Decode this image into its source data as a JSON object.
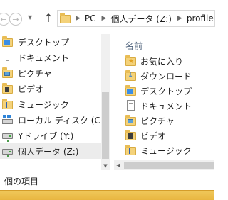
{
  "breadcrumb": {
    "items": [
      "PC",
      "個人データ (Z:)",
      "profile"
    ]
  },
  "navpane": {
    "items": [
      {
        "label": "デスクトップ",
        "icon": "desktop-folder-icon"
      },
      {
        "label": "ドキュメント",
        "icon": "documents-folder-icon"
      },
      {
        "label": "ピクチャ",
        "icon": "pictures-folder-icon"
      },
      {
        "label": "ビデオ",
        "icon": "videos-folder-icon"
      },
      {
        "label": "ミュージック",
        "icon": "music-folder-icon"
      },
      {
        "label": "ローカル ディスク (C:)",
        "icon": "local-disk-icon"
      },
      {
        "label": "Yドライブ (Y:)",
        "icon": "network-drive-icon"
      },
      {
        "label": "個人データ (Z:)",
        "icon": "network-drive-icon",
        "selected": true
      }
    ]
  },
  "content": {
    "column_header": "名前",
    "items": [
      {
        "label": "お気に入り",
        "icon": "favorites-folder-icon"
      },
      {
        "label": "ダウンロード",
        "icon": "downloads-folder-icon"
      },
      {
        "label": "デスクトップ",
        "icon": "desktop-folder-icon"
      },
      {
        "label": "ドキュメント",
        "icon": "documents-folder-icon"
      },
      {
        "label": "ピクチャ",
        "icon": "pictures-folder-icon"
      },
      {
        "label": "ビデオ",
        "icon": "videos-folder-icon"
      },
      {
        "label": "ミュージック",
        "icon": "music-folder-icon"
      }
    ]
  },
  "status": {
    "text": "個の項目"
  },
  "colors": {
    "folder": "#f4d27a",
    "selection": "#ececec",
    "accent_band": "#e8b640"
  }
}
